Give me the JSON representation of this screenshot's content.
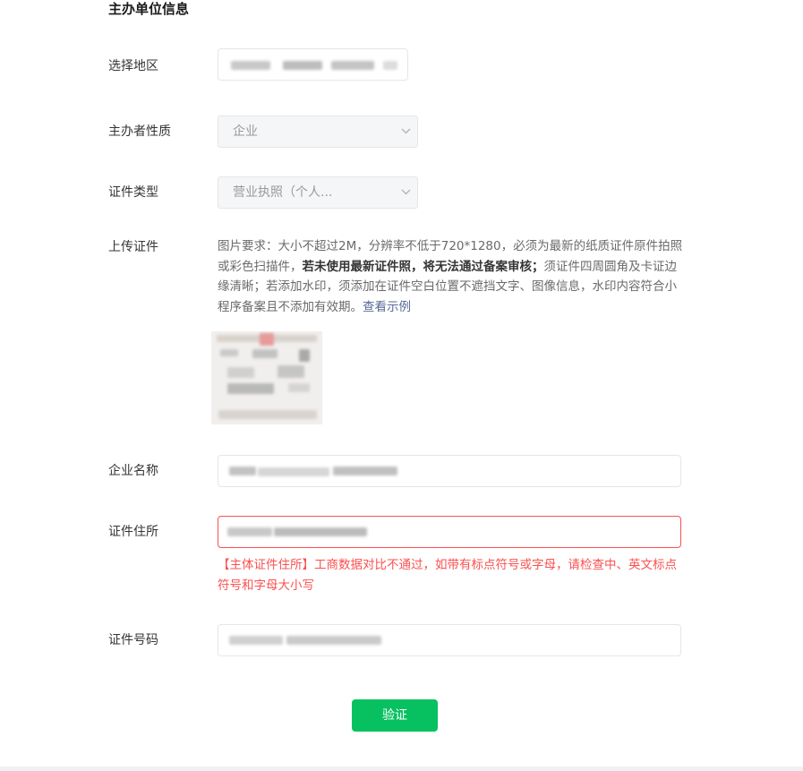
{
  "section": {
    "title": "主办单位信息"
  },
  "region": {
    "label": "选择地区"
  },
  "host_nature": {
    "label": "主办者性质",
    "value": "企业"
  },
  "cert_type": {
    "label": "证件类型",
    "value": "营业执照（个人..."
  },
  "upload": {
    "label": "上传证件",
    "desc_part1": "图片要求：大小不超过2M，分辨率不低于720*1280，必须为最新的纸质证件原件拍照或彩色扫描件，",
    "desc_bold": "若未使用最新证件照，将无法通过备案审核；",
    "desc_part2": "须证件四周圆角及卡证边缘清晰；若添加水印，须添加在证件空白位置不遮挡文字、图像信息，水印内容符合小程序备案且不添加有效期。",
    "example_link": "查看示例"
  },
  "company_name": {
    "label": "企业名称"
  },
  "address": {
    "label": "证件住所",
    "error": "【主体证件住所】工商数据对比不通过，如带有标点符号或字母，请检查中、英文标点符号和字母大小写"
  },
  "cert_number": {
    "label": "证件号码"
  },
  "verify_button": {
    "label": "验证"
  },
  "colors": {
    "accent": "#07c160",
    "error": "#fa5151",
    "link": "#576b95"
  },
  "icons": {
    "select_arrow": "chevron-down-icon"
  }
}
